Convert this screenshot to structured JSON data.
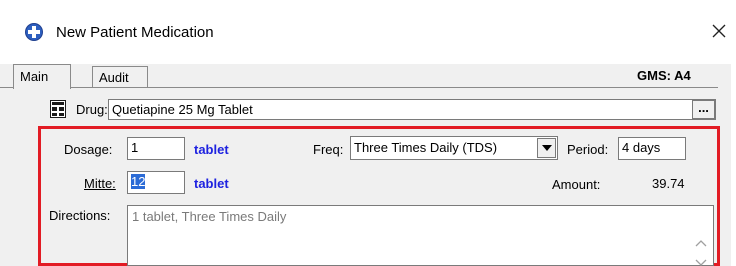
{
  "window": {
    "title": "New Patient Medication",
    "app_icon": "app-plus-globe-icon",
    "close_icon": "close-icon"
  },
  "tabs": [
    {
      "label": "Main",
      "active": true
    },
    {
      "label": "Audit",
      "active": false
    }
  ],
  "gms_label": "GMS: A4",
  "drug": {
    "label": "Drug:",
    "value": "Quetiapine 25 Mg Tablet",
    "browse_label": "...",
    "icon": "drug-list-icon"
  },
  "dosage": {
    "label": "Dosage:",
    "value": "1",
    "unit": "tablet"
  },
  "freq": {
    "label": "Freq:",
    "value": "Three Times Daily (TDS)"
  },
  "period": {
    "label": "Period:",
    "value": "4 days"
  },
  "mitte": {
    "label": "Mitte:",
    "value": "12",
    "unit": "tablet"
  },
  "amount": {
    "label": "Amount:",
    "value": "39.74"
  },
  "directions": {
    "label": "Directions:",
    "value": "1 tablet, Three Times Daily"
  },
  "colors": {
    "highlight_border": "#e21b24",
    "unit_text": "#1e22e0",
    "selection": "#2b6bd6"
  }
}
